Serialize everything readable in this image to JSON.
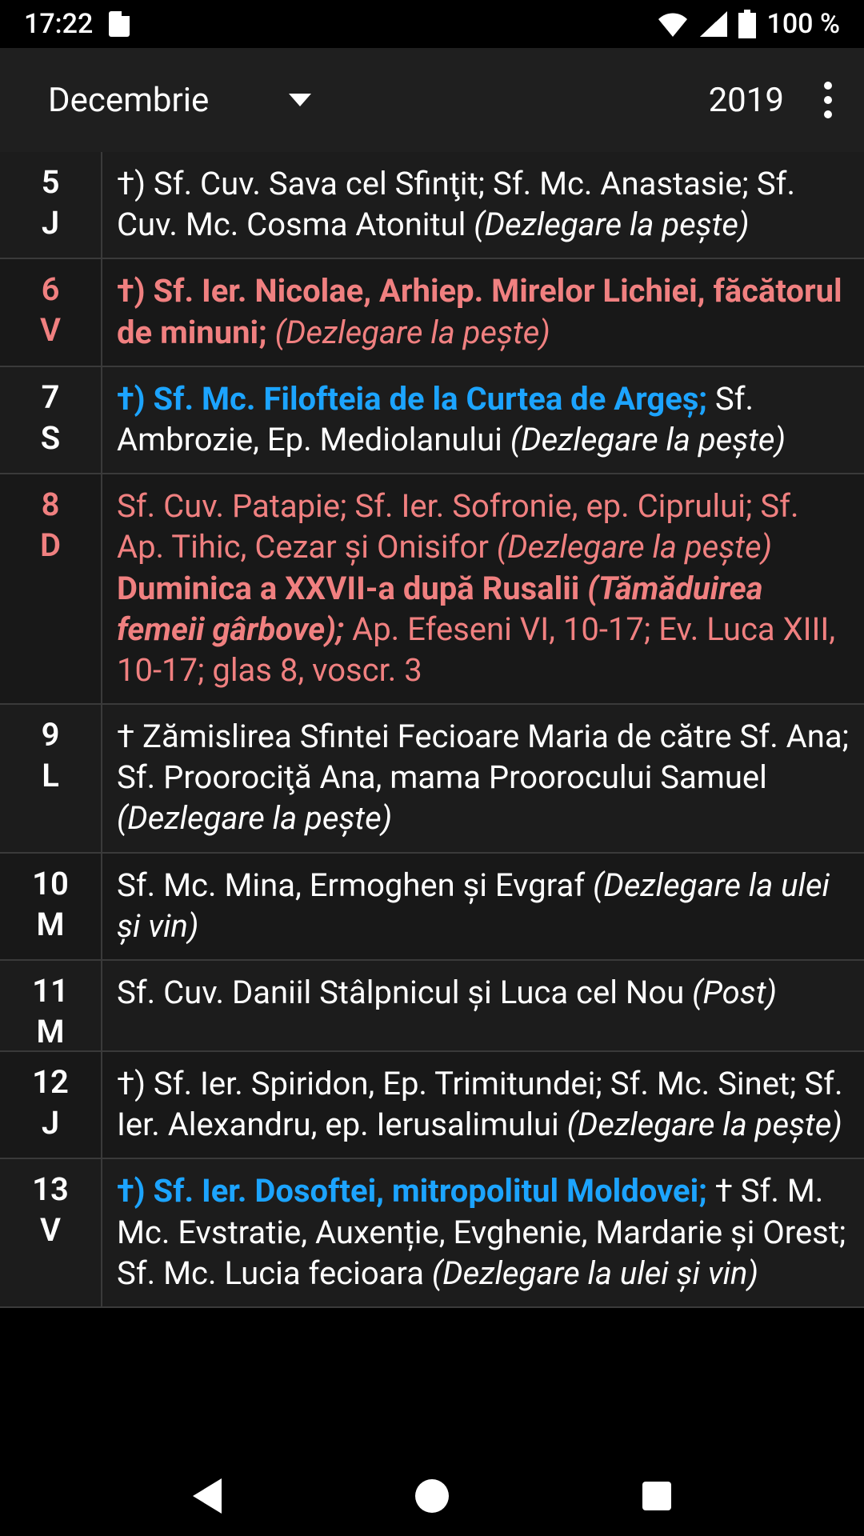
{
  "status": {
    "time": "17:22",
    "battery": "100 %"
  },
  "header": {
    "month": "Decembrie",
    "year": "2019"
  },
  "days": [
    {
      "num": "5",
      "dow": "J",
      "color": "white",
      "segments": [
        {
          "text": "†) Sf. Cuv. Sava cel Sfinţit; Sf. Mc. Anastasie; Sf. Cuv. Mc. Cosma Atonitul ",
          "cls": "white"
        },
        {
          "text": "(Dezlegare la pește)",
          "cls": "white italic"
        }
      ]
    },
    {
      "num": "6",
      "dow": "V",
      "color": "red",
      "segments": [
        {
          "text": "†) Sf. Ier. Nicolae, Arhiep. Mirelor Lichiei, făcătorul de minuni; ",
          "cls": "red bold"
        },
        {
          "text": "(Dezlegare la pește)",
          "cls": "red italic"
        }
      ]
    },
    {
      "num": "7",
      "dow": "S",
      "color": "white",
      "segments": [
        {
          "text": "†) Sf. Mc. Filofteia de la Curtea de Argeș; ",
          "cls": "blue bold"
        },
        {
          "text": "Sf. Ambrozie, Ep. Mediolanului ",
          "cls": "white"
        },
        {
          "text": "(Dezlegare la pește)",
          "cls": "white italic"
        }
      ]
    },
    {
      "num": "8",
      "dow": "D",
      "color": "red",
      "segments": [
        {
          "text": "Sf. Cuv. Patapie; Sf. Ier. Sofronie, ep. Ciprului; Sf. Ap. Tihic, Cezar și Onisifor ",
          "cls": "red"
        },
        {
          "text": "(Dezlegare la pește) ",
          "cls": "red italic"
        },
        {
          "text": "Duminica a XXVII-a după Rusalii ",
          "cls": "red bold"
        },
        {
          "text": "(Tămăduirea femeii gârbove); ",
          "cls": "red bold italic"
        },
        {
          "text": "Ap. Efeseni VI, 10-17; Ev. Luca XIII, 10-17; glas 8, voscr. 3",
          "cls": "red"
        }
      ]
    },
    {
      "num": "9",
      "dow": "L",
      "color": "white",
      "segments": [
        {
          "text": "† Zămislirea Sfintei Fecioare Maria de către Sf. Ana; Sf. Proorociţă Ana, mama Proorocului Samuel ",
          "cls": "white"
        },
        {
          "text": "(Dezlegare la pește)",
          "cls": "white italic"
        }
      ]
    },
    {
      "num": "10",
      "dow": "M",
      "color": "white",
      "segments": [
        {
          "text": "Sf. Mc. Mina, Ermoghen și Evgraf ",
          "cls": "white"
        },
        {
          "text": "(Dezlegare la ulei și vin)",
          "cls": "white italic"
        }
      ]
    },
    {
      "num": "11",
      "dow": "M",
      "color": "white",
      "segments": [
        {
          "text": "Sf. Cuv. Daniil Stâlpnicul și Luca cel Nou ",
          "cls": "white"
        },
        {
          "text": "(Post)",
          "cls": "white italic"
        }
      ]
    },
    {
      "num": "12",
      "dow": "J",
      "color": "white",
      "segments": [
        {
          "text": "†) Sf. Ier. Spiridon, Ep. Trimitundei; Sf. Mc. Sinet; Sf. Ier. Alexandru, ep. Ierusalimului ",
          "cls": "white"
        },
        {
          "text": "(Dezlegare la pește)",
          "cls": "white italic"
        }
      ]
    },
    {
      "num": "13",
      "dow": "V",
      "color": "white",
      "segments": [
        {
          "text": "†) Sf. Ier. Dosoftei, mitropolitul Moldovei; ",
          "cls": "blue bold"
        },
        {
          "text": "† Sf. M. Mc. Evstratie, Auxenție, Evghenie, Mardarie și Orest; Sf. Mc. Lucia fecioara ",
          "cls": "white"
        },
        {
          "text": "(Dezlegare la ulei și vin)",
          "cls": "white italic"
        }
      ]
    }
  ]
}
